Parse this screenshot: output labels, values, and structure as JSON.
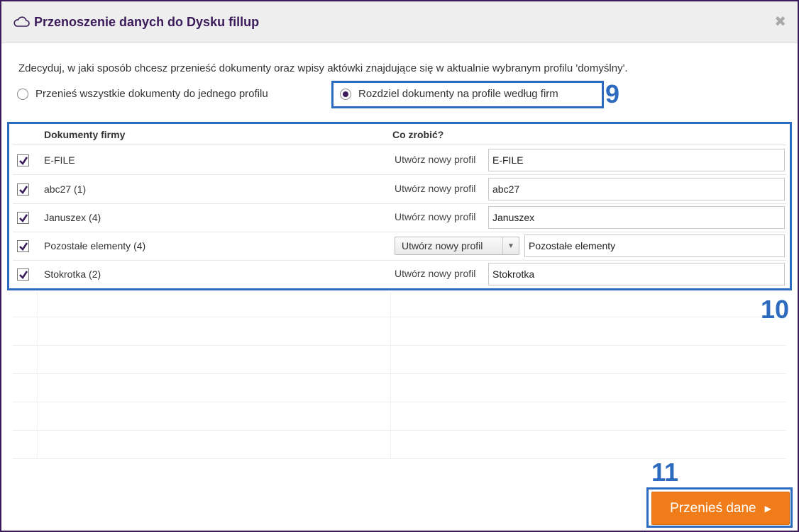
{
  "dialog": {
    "title": "Przenoszenie danych do Dysku fillup",
    "title_icon": "cloud-icon",
    "close_icon": "close-icon",
    "close_glyph": "✖"
  },
  "description": "Zdecyduj, w jaki sposób chcesz przenieść dokumenty oraz wpisy aktówki znajdujące się w aktualnie wybranym profilu 'domyślny'.",
  "options": [
    {
      "label": "Przenieś wszystkie dokumenty do jednego profilu",
      "selected": false
    },
    {
      "label": "Rozdziel dokumenty na profile według firm",
      "selected": true
    }
  ],
  "table": {
    "headers": {
      "company": "Dokumenty firmy",
      "action": "Co zrobić?"
    },
    "rows": [
      {
        "checked": true,
        "name": "E-FILE",
        "action": "Utwórz nowy profil",
        "value": "E-FILE",
        "has_select": false
      },
      {
        "checked": true,
        "name": "abc27 (1)",
        "action": "Utwórz nowy profil",
        "value": "abc27",
        "has_select": false
      },
      {
        "checked": true,
        "name": "Januszex (4)",
        "action": "Utwórz nowy profil",
        "value": "Januszex",
        "has_select": false
      },
      {
        "checked": true,
        "name": "Pozostałe elementy (4)",
        "action": "Utwórz nowy profil",
        "value": "Pozostałe elementy",
        "has_select": true
      },
      {
        "checked": true,
        "name": "Stokrotka (2)",
        "action": "Utwórz nowy profil",
        "value": "Stokrotka",
        "has_select": false
      }
    ]
  },
  "submit": {
    "label": "Przenieś dane",
    "arrow": "▶"
  },
  "annotations": {
    "n9": "9",
    "n10": "10",
    "n11": "11"
  },
  "colors": {
    "accent": "#3b1b5a",
    "annotation": "#2d6bbf",
    "submit": "#f07d1a"
  }
}
